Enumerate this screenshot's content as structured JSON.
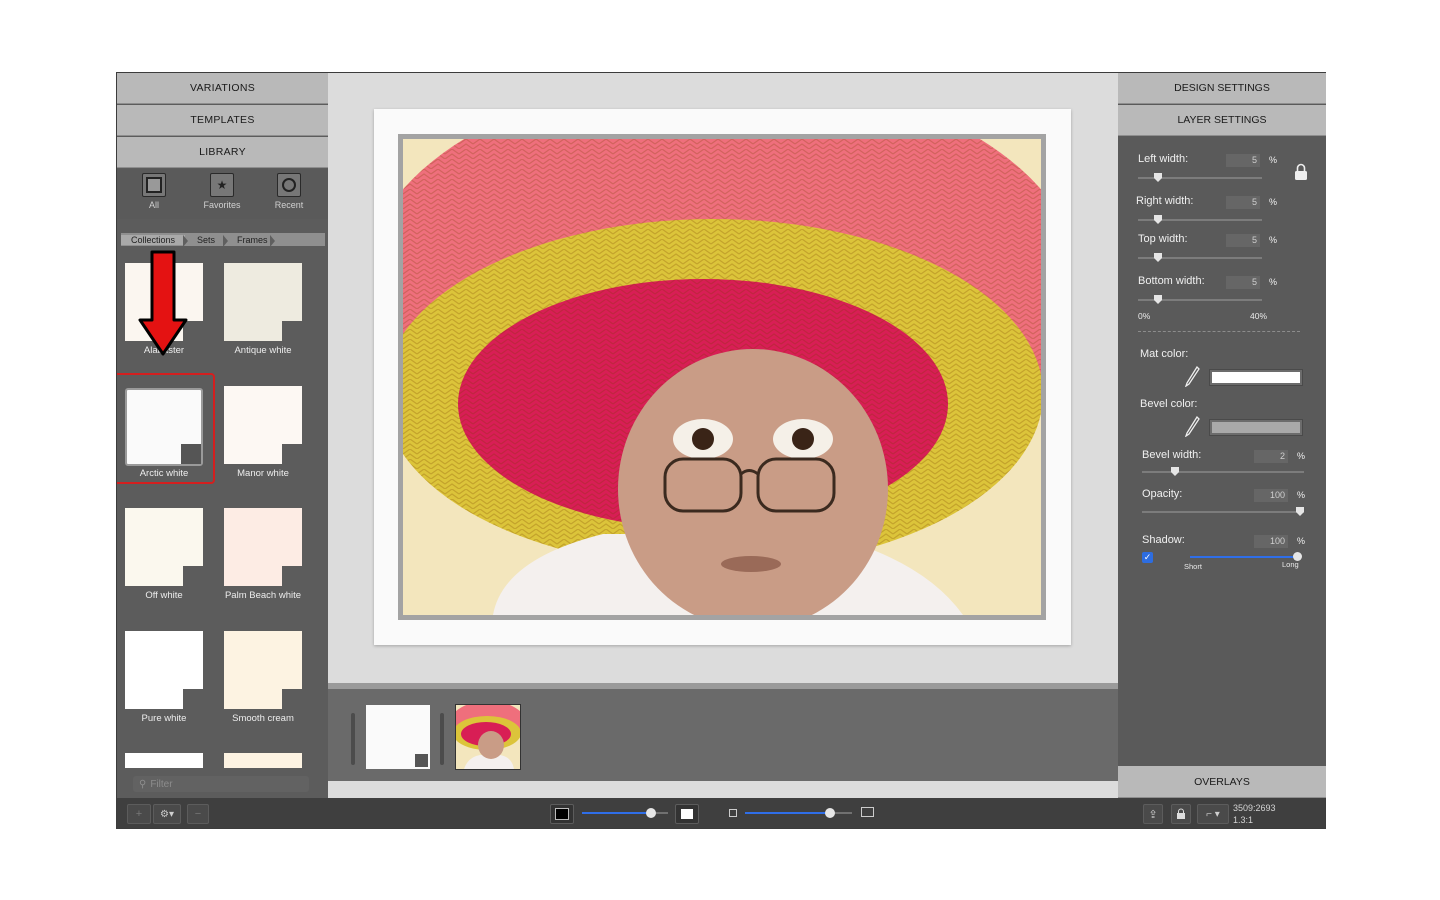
{
  "left_panel": {
    "sections": [
      "VARIATIONS",
      "TEMPLATES",
      "LIBRARY"
    ],
    "library_tools": [
      {
        "label": "All",
        "icon": "frame-square-icon"
      },
      {
        "label": "Favorites",
        "icon": "star-icon"
      },
      {
        "label": "Recent",
        "icon": "clock-icon"
      }
    ],
    "breadcrumbs": [
      "Collections",
      "Sets",
      "Frames"
    ],
    "mats": [
      {
        "label": "Alabaster",
        "color": "#fbf6f0"
      },
      {
        "label": "Antique white",
        "color": "#eeebe0"
      },
      {
        "label": "Arctic white",
        "color": "#fafafa",
        "selected": true
      },
      {
        "label": "Manor white",
        "color": "#fdf8f3"
      },
      {
        "label": "Off white",
        "color": "#fbf8ee"
      },
      {
        "label": "Palm Beach white",
        "color": "#fdece4"
      },
      {
        "label": "Pure white",
        "color": "#ffffff"
      },
      {
        "label": "Smooth cream",
        "color": "#fdf3e2"
      }
    ],
    "filter_placeholder": "Filter",
    "annotation_color": "#d41f1f"
  },
  "right_panel": {
    "sections": [
      "DESIGN SETTINGS",
      "LAYER SETTINGS",
      "OVERLAYS"
    ],
    "widths": [
      {
        "label": "Left width:",
        "value": "5",
        "unit": "%"
      },
      {
        "label": "Right width:",
        "value": "5",
        "unit": "%"
      },
      {
        "label": "Top width:",
        "value": "5",
        "unit": "%"
      },
      {
        "label": "Bottom width:",
        "value": "5",
        "unit": "%"
      }
    ],
    "range_min": "0%",
    "range_max": "40%",
    "mat_color_label": "Mat color:",
    "mat_color": "#ffffff",
    "bevel_color_label": "Bevel color:",
    "bevel_color": "#a9a9a9",
    "bevel_width": {
      "label": "Bevel width:",
      "value": "2",
      "unit": "%"
    },
    "opacity": {
      "label": "Opacity:",
      "value": "100",
      "unit": "%"
    },
    "shadow": {
      "label": "Shadow:",
      "value": "100",
      "unit": "%",
      "checked": true,
      "min_label": "Short",
      "max_label": "Long"
    }
  },
  "bottom_bar": {
    "dimensions": "3509:2693",
    "ratio": "1.3:1",
    "left_buttons": [
      "+",
      "⚙▾",
      "−"
    ]
  },
  "accent_color": "#2f6ee8"
}
